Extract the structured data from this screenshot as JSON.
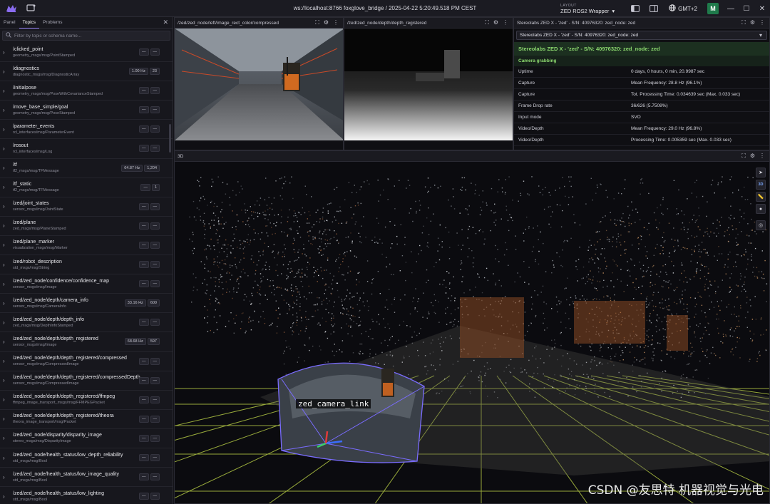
{
  "topbar": {
    "title": "ws://localhost:8766 foxglove_bridge / 2025-04-22 5:20:49.518 PM CEST",
    "layout_label": "LAYOUT",
    "layout_name": "ZED ROS2 Wrapper",
    "timezone": "GMT+2",
    "user_initial": "M"
  },
  "sidebar": {
    "tabs": [
      "Panel",
      "Topics",
      "Problems"
    ],
    "active_tab": "Topics",
    "search_placeholder": "Filter by topic or schema name...",
    "topics": [
      {
        "name": "/clicked_point",
        "schema": "geometry_msgs/msg/PointStamped",
        "hz": "—",
        "count": "—"
      },
      {
        "name": "/diagnostics",
        "schema": "diagnostic_msgs/msg/DiagnosticArray",
        "hz": "1.00 Hz",
        "count": "23"
      },
      {
        "name": "/initialpose",
        "schema": "geometry_msgs/msg/PoseWithCovarianceStamped",
        "hz": "—",
        "count": "—"
      },
      {
        "name": "/move_base_simple/goal",
        "schema": "geometry_msgs/msg/PoseStamped",
        "hz": "—",
        "count": "—"
      },
      {
        "name": "/parameter_events",
        "schema": "rcl_interfaces/msg/ParameterEvent",
        "hz": "—",
        "count": "—"
      },
      {
        "name": "/rosout",
        "schema": "rcl_interfaces/msg/Log",
        "hz": "—",
        "count": "—"
      },
      {
        "name": "/tf",
        "schema": "tf2_msgs/msg/TFMessage",
        "hz": "64.87 Hz",
        "count": "1,204"
      },
      {
        "name": "/tf_static",
        "schema": "tf2_msgs/msg/TFMessage",
        "hz": "—",
        "count": "1"
      },
      {
        "name": "/zed/joint_states",
        "schema": "sensor_msgs/msg/JointState",
        "hz": "—",
        "count": "—"
      },
      {
        "name": "/zed/plane",
        "schema": "zed_msgs/msg/PlaneStamped",
        "hz": "—",
        "count": "—"
      },
      {
        "name": "/zed/plane_marker",
        "schema": "visualization_msgs/msg/Marker",
        "hz": "—",
        "count": "—"
      },
      {
        "name": "/zed/robot_description",
        "schema": "std_msgs/msg/String",
        "hz": "—",
        "count": "—"
      },
      {
        "name": "/zed/zed_node/confidence/confidence_map",
        "schema": "sensor_msgs/msg/Image",
        "hz": "—",
        "count": "—"
      },
      {
        "name": "/zed/zed_node/depth/camera_info",
        "schema": "sensor_msgs/msg/CameraInfo",
        "hz": "33.16 Hz",
        "count": "600"
      },
      {
        "name": "/zed/zed_node/depth/depth_info",
        "schema": "zed_msgs/msg/DepthInfoStamped",
        "hz": "—",
        "count": "—"
      },
      {
        "name": "/zed/zed_node/depth/depth_registered",
        "schema": "sensor_msgs/msg/Image",
        "hz": "68.68 Hz",
        "count": "597"
      },
      {
        "name": "/zed/zed_node/depth/depth_registered/compressed",
        "schema": "sensor_msgs/msg/CompressedImage",
        "hz": "—",
        "count": "—"
      },
      {
        "name": "/zed/zed_node/depth/depth_registered/compressedDepth",
        "schema": "sensor_msgs/msg/CompressedImage",
        "hz": "—",
        "count": "—"
      },
      {
        "name": "/zed/zed_node/depth/depth_registered/ffmpeg",
        "schema": "ffmpeg_image_transport_msgs/msg/FFMPEGPacket",
        "hz": "—",
        "count": "—"
      },
      {
        "name": "/zed/zed_node/depth/depth_registered/theora",
        "schema": "theora_image_transport/msg/Packet",
        "hz": "—",
        "count": "—"
      },
      {
        "name": "/zed/zed_node/disparity/disparity_image",
        "schema": "stereo_msgs/msg/DisparityImage",
        "hz": "—",
        "count": "—"
      },
      {
        "name": "/zed/zed_node/health_status/low_depth_reliability",
        "schema": "std_msgs/msg/Bool",
        "hz": "—",
        "count": "—"
      },
      {
        "name": "/zed/zed_node/health_status/low_image_quality",
        "schema": "std_msgs/msg/Bool",
        "hz": "—",
        "count": "—"
      },
      {
        "name": "/zed/zed_node/health_status/low_lighting",
        "schema": "std_msgs/msg/Bool",
        "hz": "—",
        "count": "—"
      }
    ]
  },
  "panels": {
    "image_title": "/zed/zed_node/left/image_rect_color/compressed",
    "depth_title": "/zed/zed_node/depth/depth_registered",
    "zed_title": "Stereolabs ZED X - 'zed' - S/N: 40976320: zed_node: zed",
    "view3d_title": "3D"
  },
  "zed_info": {
    "select_value": "Stereolabs ZED X - 'zed' - S/N: 40976320: zed_node: zed",
    "header": "Stereolabs ZED X - 'zed' - S/N: 40976320: zed_node: zed",
    "group": "Camera grabbing",
    "rows": [
      {
        "key": "Uptime",
        "value": "0 days, 0 hours, 0 min, 20.9987 sec"
      },
      {
        "key": "Capture",
        "value": "Mean Frequency: 28.8 Hz (96.1%)"
      },
      {
        "key": "Capture",
        "value": "Tot. Processing Time: 0.034639 sec (Max. 0.033 sec)"
      },
      {
        "key": "Frame Drop rate",
        "value": "36/626 (5.7508%)"
      },
      {
        "key": "Input mode",
        "value": "SVO"
      },
      {
        "key": "Video/Depth",
        "value": "Mean Frequency: 29.0 Hz (96.8%)"
      },
      {
        "key": "Video/Depth",
        "value": "Processing Time: 0.005359 sec (Max. 0.033 sec)"
      }
    ]
  },
  "view3d": {
    "frame_label": "zed_camera_link",
    "tool_mode": "3D"
  },
  "watermark": "CSDN @友思特 机器视觉与光电",
  "colors": {
    "accent": "#a08bff",
    "zed_green": "#8bd76e",
    "grid": "#c8e04a",
    "frustum": "#7a6cff"
  }
}
